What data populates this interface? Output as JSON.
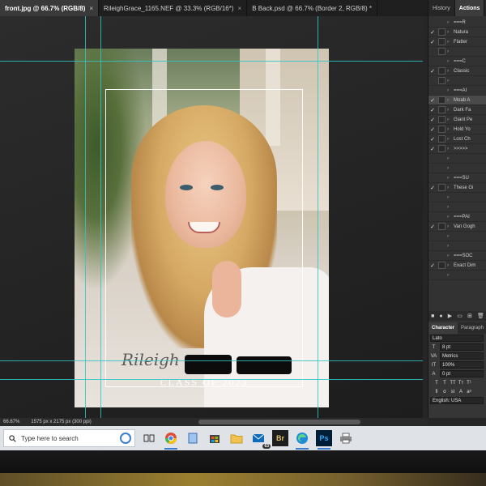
{
  "tabs": [
    {
      "label": "front.jpg @ 66.7% (RGB/8)",
      "active": true
    },
    {
      "label": "RileighGrace_1165.NEF @ 33.3% (RGB/16*)",
      "active": false
    },
    {
      "label": "B Back.psd @ 66.7% (Border 2, RGB/8) *",
      "active": false
    }
  ],
  "tab_close": "×",
  "panel_tabs": [
    "History",
    "Actions"
  ],
  "actions": [
    {
      "label": "===R",
      "check": "",
      "box": false,
      "caret": "›"
    },
    {
      "label": "Natura",
      "check": "✓",
      "box": true,
      "caret": "›"
    },
    {
      "label": "Flatter",
      "check": "✓",
      "box": true,
      "caret": "›"
    },
    {
      "label": "",
      "check": "",
      "box": true,
      "caret": "›"
    },
    {
      "label": "===C",
      "check": "",
      "box": false,
      "caret": "›"
    },
    {
      "label": "Classic",
      "check": "✓",
      "box": true,
      "caret": "›"
    },
    {
      "label": "",
      "check": "",
      "box": true,
      "caret": "›"
    },
    {
      "label": "===AI",
      "check": "",
      "box": false,
      "caret": "›"
    },
    {
      "label": "Moab A",
      "check": "✓",
      "box": true,
      "caret": "›",
      "highlight": true
    },
    {
      "label": "Dark Fa",
      "check": "✓",
      "box": true,
      "caret": "›"
    },
    {
      "label": "Giant Pe",
      "check": "✓",
      "box": true,
      "caret": "›"
    },
    {
      "label": "Hold Yo",
      "check": "✓",
      "box": true,
      "caret": "›"
    },
    {
      "label": "Lost Ch",
      "check": "✓",
      "box": true,
      "caret": "›"
    },
    {
      "label": ">>>>>",
      "check": "✓",
      "box": true,
      "caret": "›"
    },
    {
      "label": "",
      "check": "",
      "box": false,
      "caret": "›"
    },
    {
      "label": "",
      "check": "",
      "box": false,
      "caret": "›"
    },
    {
      "label": "===SU",
      "check": "",
      "box": false,
      "caret": "›"
    },
    {
      "label": "These Gi",
      "check": "✓",
      "box": true,
      "caret": "›"
    },
    {
      "label": "",
      "check": "",
      "box": false,
      "caret": "›"
    },
    {
      "label": "",
      "check": "",
      "box": false,
      "caret": "›"
    },
    {
      "label": "===PAI",
      "check": "",
      "box": false,
      "caret": "›"
    },
    {
      "label": "Van Gogh",
      "check": "✓",
      "box": true,
      "caret": "›"
    },
    {
      "label": "",
      "check": "",
      "box": false,
      "caret": "›"
    },
    {
      "label": "",
      "check": "",
      "box": false,
      "caret": "›"
    },
    {
      "label": "===SOC",
      "check": "",
      "box": false,
      "caret": "›"
    },
    {
      "label": "Exact Dim",
      "check": "✓",
      "box": true,
      "caret": "›"
    },
    {
      "label": "",
      "check": "",
      "box": false,
      "caret": "›"
    }
  ],
  "action_controls": [
    "■",
    "●",
    "▶",
    "▭",
    "⊞",
    "🗑"
  ],
  "character_tabs": [
    "Character",
    "Paragraph"
  ],
  "character": {
    "font": "Lato",
    "size": "8 pt",
    "kerning": "Metrics",
    "scale": "100%",
    "baseline": "0 pt",
    "language": "English: USA"
  },
  "document": {
    "name_script": "Rileigh",
    "class_line": "CLASS OF 2023"
  },
  "status": {
    "zoom": "66.67%",
    "doc_size": "1575 px x 2175 px (300 ppi)"
  },
  "taskbar": {
    "search_placeholder": "Type here to search",
    "mail_badge": "63",
    "apps": [
      "task-view",
      "chrome",
      "notepad",
      "store",
      "file-explorer",
      "mail",
      "bridge",
      "edge",
      "photoshop",
      "printer"
    ],
    "labels": {
      "bridge": "Br",
      "photoshop": "Ps"
    }
  },
  "colors": {
    "guide": "#30c6c6",
    "taskbar": "#dfe3e8",
    "panel": "#323232"
  }
}
